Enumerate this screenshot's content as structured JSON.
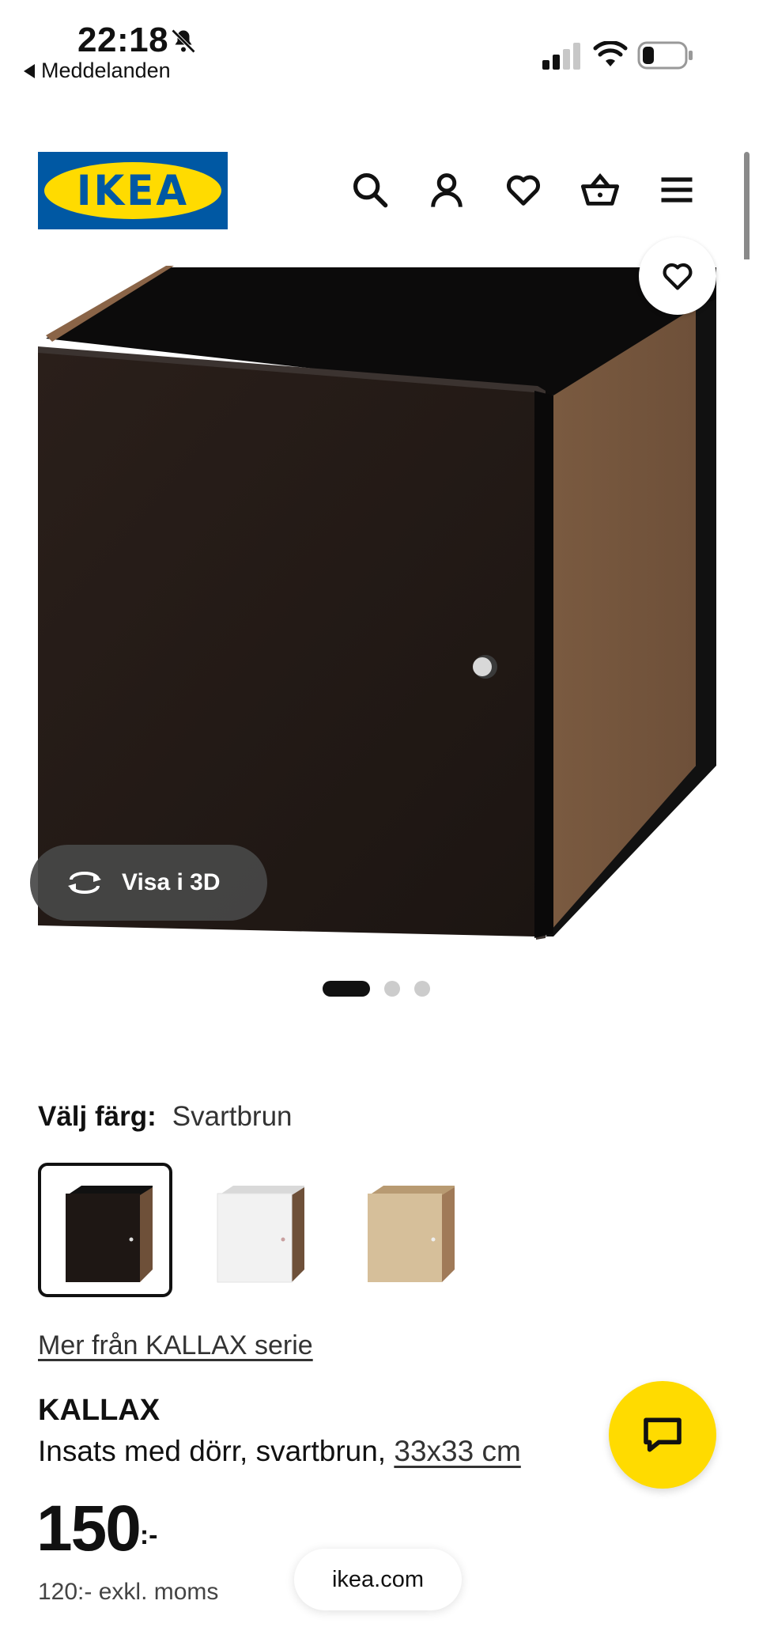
{
  "status_bar": {
    "time": "22:18",
    "back_app": "Meddelanden",
    "icons": [
      "bell-slash-icon",
      "signal-icon",
      "wifi-icon",
      "battery-icon"
    ]
  },
  "header": {
    "logo_text": "IKEA",
    "icons": [
      "search-icon",
      "account-icon",
      "heart-icon",
      "basket-icon",
      "menu-icon"
    ]
  },
  "gallery": {
    "view_3d_label": "Visa i 3D",
    "slide_count": 3,
    "active_slide": 1
  },
  "color": {
    "label": "Välj färg:",
    "value": "Svartbrun",
    "swatches": [
      "Svartbrun",
      "Vit",
      "Vitlaserad ekeffekt"
    ],
    "selected_index": 0
  },
  "product": {
    "series_link": "Mer från KALLAX serie",
    "name": "KALLAX",
    "description": "Insats med dörr, svartbrun,",
    "size_link": "33x33 cm",
    "price": "150",
    "price_suffix": ":-",
    "price_ex_vat": "120:- exkl. moms"
  },
  "browser": {
    "url": "ikea.com"
  },
  "colors": {
    "ikea_blue": "#0058a3",
    "ikea_yellow": "#ffdb00"
  }
}
